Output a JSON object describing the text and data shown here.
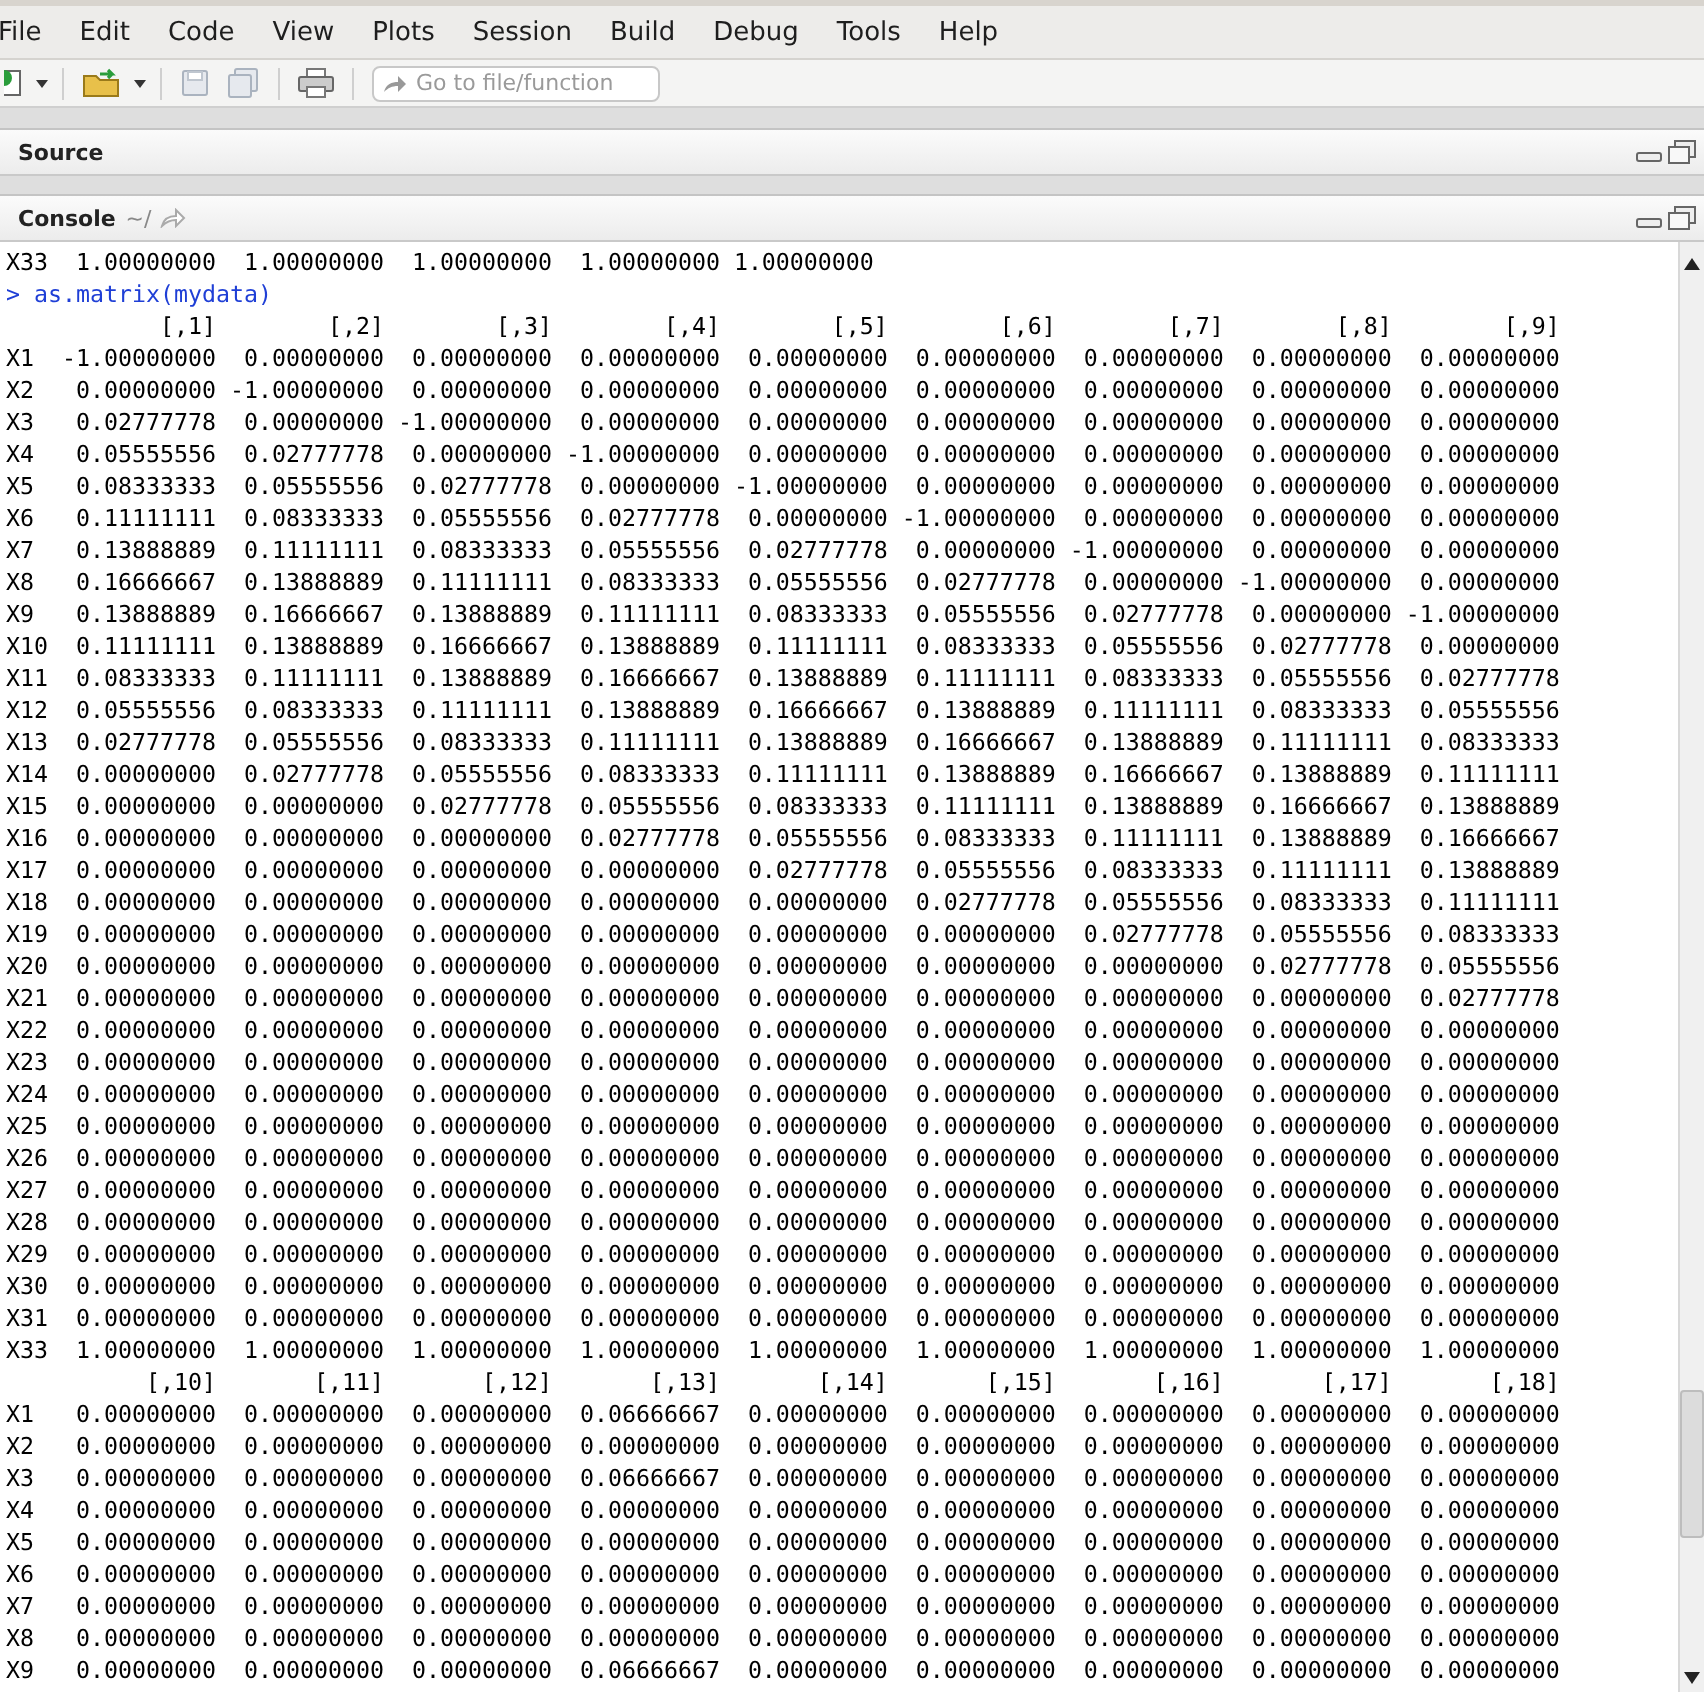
{
  "menu": [
    "File",
    "Edit",
    "Code",
    "View",
    "Plots",
    "Session",
    "Build",
    "Debug",
    "Tools",
    "Help"
  ],
  "toolbar": {
    "goto_placeholder": "Go to file/function"
  },
  "source_pane": {
    "title": "Source"
  },
  "console": {
    "title": "Console",
    "path": "~/",
    "lines": [
      {
        "kind": "output",
        "text": "X33  1.00000000  1.00000000  1.00000000  1.00000000 1.00000000"
      },
      {
        "kind": "command",
        "prompt": ">",
        "text": "as.matrix(mydata)"
      },
      {
        "kind": "output",
        "text": "           [,1]        [,2]        [,3]        [,4]        [,5]        [,6]        [,7]        [,8]        [,9]"
      },
      {
        "kind": "output",
        "text": "X1  -1.00000000  0.00000000  0.00000000  0.00000000  0.00000000  0.00000000  0.00000000  0.00000000  0.00000000"
      },
      {
        "kind": "output",
        "text": "X2   0.00000000 -1.00000000  0.00000000  0.00000000  0.00000000  0.00000000  0.00000000  0.00000000  0.00000000"
      },
      {
        "kind": "output",
        "text": "X3   0.02777778  0.00000000 -1.00000000  0.00000000  0.00000000  0.00000000  0.00000000  0.00000000  0.00000000"
      },
      {
        "kind": "output",
        "text": "X4   0.05555556  0.02777778  0.00000000 -1.00000000  0.00000000  0.00000000  0.00000000  0.00000000  0.00000000"
      },
      {
        "kind": "output",
        "text": "X5   0.08333333  0.05555556  0.02777778  0.00000000 -1.00000000  0.00000000  0.00000000  0.00000000  0.00000000"
      },
      {
        "kind": "output",
        "text": "X6   0.11111111  0.08333333  0.05555556  0.02777778  0.00000000 -1.00000000  0.00000000  0.00000000  0.00000000"
      },
      {
        "kind": "output",
        "text": "X7   0.13888889  0.11111111  0.08333333  0.05555556  0.02777778  0.00000000 -1.00000000  0.00000000  0.00000000"
      },
      {
        "kind": "output",
        "text": "X8   0.16666667  0.13888889  0.11111111  0.08333333  0.05555556  0.02777778  0.00000000 -1.00000000  0.00000000"
      },
      {
        "kind": "output",
        "text": "X9   0.13888889  0.16666667  0.13888889  0.11111111  0.08333333  0.05555556  0.02777778  0.00000000 -1.00000000"
      },
      {
        "kind": "output",
        "text": "X10  0.11111111  0.13888889  0.16666667  0.13888889  0.11111111  0.08333333  0.05555556  0.02777778  0.00000000"
      },
      {
        "kind": "output",
        "text": "X11  0.08333333  0.11111111  0.13888889  0.16666667  0.13888889  0.11111111  0.08333333  0.05555556  0.02777778"
      },
      {
        "kind": "output",
        "text": "X12  0.05555556  0.08333333  0.11111111  0.13888889  0.16666667  0.13888889  0.11111111  0.08333333  0.05555556"
      },
      {
        "kind": "output",
        "text": "X13  0.02777778  0.05555556  0.08333333  0.11111111  0.13888889  0.16666667  0.13888889  0.11111111  0.08333333"
      },
      {
        "kind": "output",
        "text": "X14  0.00000000  0.02777778  0.05555556  0.08333333  0.11111111  0.13888889  0.16666667  0.13888889  0.11111111"
      },
      {
        "kind": "output",
        "text": "X15  0.00000000  0.00000000  0.02777778  0.05555556  0.08333333  0.11111111  0.13888889  0.16666667  0.13888889"
      },
      {
        "kind": "output",
        "text": "X16  0.00000000  0.00000000  0.00000000  0.02777778  0.05555556  0.08333333  0.11111111  0.13888889  0.16666667"
      },
      {
        "kind": "output",
        "text": "X17  0.00000000  0.00000000  0.00000000  0.00000000  0.02777778  0.05555556  0.08333333  0.11111111  0.13888889"
      },
      {
        "kind": "output",
        "text": "X18  0.00000000  0.00000000  0.00000000  0.00000000  0.00000000  0.02777778  0.05555556  0.08333333  0.11111111"
      },
      {
        "kind": "output",
        "text": "X19  0.00000000  0.00000000  0.00000000  0.00000000  0.00000000  0.00000000  0.02777778  0.05555556  0.08333333"
      },
      {
        "kind": "output",
        "text": "X20  0.00000000  0.00000000  0.00000000  0.00000000  0.00000000  0.00000000  0.00000000  0.02777778  0.05555556"
      },
      {
        "kind": "output",
        "text": "X21  0.00000000  0.00000000  0.00000000  0.00000000  0.00000000  0.00000000  0.00000000  0.00000000  0.02777778"
      },
      {
        "kind": "output",
        "text": "X22  0.00000000  0.00000000  0.00000000  0.00000000  0.00000000  0.00000000  0.00000000  0.00000000  0.00000000"
      },
      {
        "kind": "output",
        "text": "X23  0.00000000  0.00000000  0.00000000  0.00000000  0.00000000  0.00000000  0.00000000  0.00000000  0.00000000"
      },
      {
        "kind": "output",
        "text": "X24  0.00000000  0.00000000  0.00000000  0.00000000  0.00000000  0.00000000  0.00000000  0.00000000  0.00000000"
      },
      {
        "kind": "output",
        "text": "X25  0.00000000  0.00000000  0.00000000  0.00000000  0.00000000  0.00000000  0.00000000  0.00000000  0.00000000"
      },
      {
        "kind": "output",
        "text": "X26  0.00000000  0.00000000  0.00000000  0.00000000  0.00000000  0.00000000  0.00000000  0.00000000  0.00000000"
      },
      {
        "kind": "output",
        "text": "X27  0.00000000  0.00000000  0.00000000  0.00000000  0.00000000  0.00000000  0.00000000  0.00000000  0.00000000"
      },
      {
        "kind": "output",
        "text": "X28  0.00000000  0.00000000  0.00000000  0.00000000  0.00000000  0.00000000  0.00000000  0.00000000  0.00000000"
      },
      {
        "kind": "output",
        "text": "X29  0.00000000  0.00000000  0.00000000  0.00000000  0.00000000  0.00000000  0.00000000  0.00000000  0.00000000"
      },
      {
        "kind": "output",
        "text": "X30  0.00000000  0.00000000  0.00000000  0.00000000  0.00000000  0.00000000  0.00000000  0.00000000  0.00000000"
      },
      {
        "kind": "output",
        "text": "X31  0.00000000  0.00000000  0.00000000  0.00000000  0.00000000  0.00000000  0.00000000  0.00000000  0.00000000"
      },
      {
        "kind": "output",
        "text": "X33  1.00000000  1.00000000  1.00000000  1.00000000  1.00000000  1.00000000  1.00000000  1.00000000  1.00000000"
      },
      {
        "kind": "output",
        "text": "          [,10]       [,11]       [,12]       [,13]       [,14]       [,15]       [,16]       [,17]       [,18]"
      },
      {
        "kind": "output",
        "text": "X1   0.00000000  0.00000000  0.00000000  0.06666667  0.00000000  0.00000000  0.00000000  0.00000000  0.00000000"
      },
      {
        "kind": "output",
        "text": "X2   0.00000000  0.00000000  0.00000000  0.00000000  0.00000000  0.00000000  0.00000000  0.00000000  0.00000000"
      },
      {
        "kind": "output",
        "text": "X3   0.00000000  0.00000000  0.00000000  0.06666667  0.00000000  0.00000000  0.00000000  0.00000000  0.00000000"
      },
      {
        "kind": "output",
        "text": "X4   0.00000000  0.00000000  0.00000000  0.00000000  0.00000000  0.00000000  0.00000000  0.00000000  0.00000000"
      },
      {
        "kind": "output",
        "text": "X5   0.00000000  0.00000000  0.00000000  0.00000000  0.00000000  0.00000000  0.00000000  0.00000000  0.00000000"
      },
      {
        "kind": "output",
        "text": "X6   0.00000000  0.00000000  0.00000000  0.00000000  0.00000000  0.00000000  0.00000000  0.00000000  0.00000000"
      },
      {
        "kind": "output",
        "text": "X7   0.00000000  0.00000000  0.00000000  0.00000000  0.00000000  0.00000000  0.00000000  0.00000000  0.00000000"
      },
      {
        "kind": "output",
        "text": "X8   0.00000000  0.00000000  0.00000000  0.00000000  0.00000000  0.00000000  0.00000000  0.00000000  0.00000000"
      },
      {
        "kind": "output",
        "text": "X9   0.00000000  0.00000000  0.00000000  0.06666667  0.00000000  0.00000000  0.00000000  0.00000000  0.00000000"
      }
    ]
  }
}
